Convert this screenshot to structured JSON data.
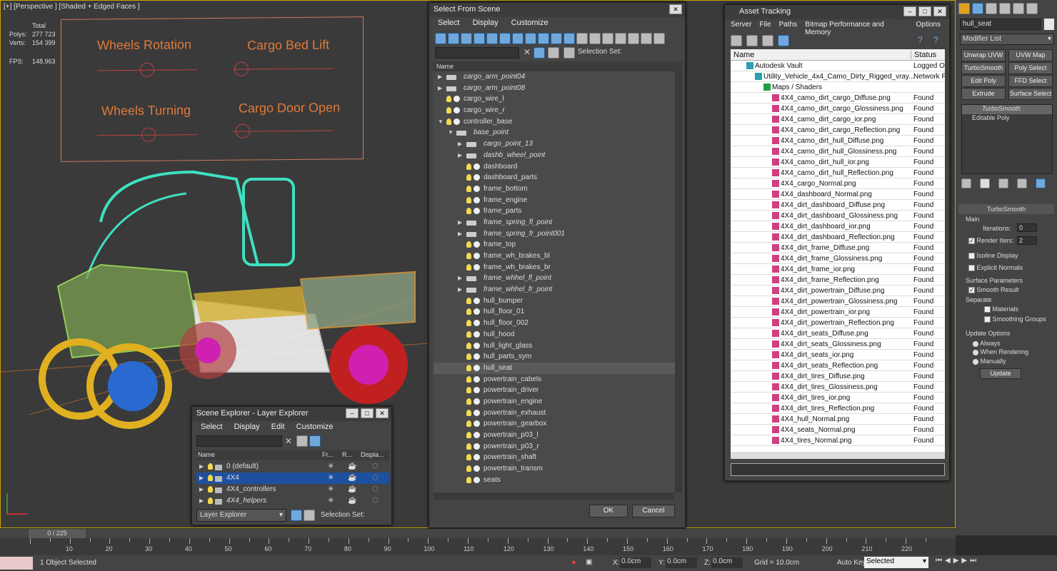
{
  "viewport": {
    "label": "[+] [Perspective ] [Shaded + Edged Faces ]",
    "stats": {
      "total_label": "Total",
      "polys_label": "Polys:",
      "polys": "277 723",
      "verts_label": "Verts:",
      "verts": "154 399",
      "fps_label": "FPS:",
      "fps": "148.963"
    },
    "controls": [
      "Wheels Rotation",
      "Cargo Bed Lift",
      "Wheels Turning",
      "Cargo Door Open"
    ]
  },
  "select_from_scene": {
    "title": "Select From Scene",
    "menu": [
      "Select",
      "Display",
      "Customize"
    ],
    "selection_set_label": "Selection Set:",
    "column_name": "Name",
    "ok": "OK",
    "cancel": "Cancel",
    "rows": [
      {
        "name": "cargo_arm_point04",
        "level": 0,
        "type": "helper",
        "expand": "right",
        "italic": true
      },
      {
        "name": "cargo_arm_point08",
        "level": 0,
        "type": "helper",
        "expand": "right",
        "italic": true
      },
      {
        "name": "cargo_wire_l",
        "level": 0,
        "type": "mesh",
        "expand": "",
        "italic": false
      },
      {
        "name": "cargo_wire_r",
        "level": 0,
        "type": "mesh",
        "expand": "",
        "italic": false
      },
      {
        "name": "controller_base",
        "level": 0,
        "type": "mesh2",
        "expand": "down",
        "italic": false
      },
      {
        "name": "base_point",
        "level": 1,
        "type": "helper",
        "expand": "down",
        "italic": true
      },
      {
        "name": "cargo_point_13",
        "level": 2,
        "type": "helper",
        "expand": "right",
        "italic": true
      },
      {
        "name": "dashb_wheel_point",
        "level": 2,
        "type": "helper",
        "expand": "right",
        "italic": true
      },
      {
        "name": "dashboard",
        "level": 2,
        "type": "mesh",
        "expand": "",
        "italic": false
      },
      {
        "name": "dashboard_parts",
        "level": 2,
        "type": "mesh",
        "expand": "",
        "italic": false
      },
      {
        "name": "frame_bottom",
        "level": 2,
        "type": "mesh",
        "expand": "",
        "italic": false
      },
      {
        "name": "frame_engine",
        "level": 2,
        "type": "mesh",
        "expand": "",
        "italic": false
      },
      {
        "name": "frame_parts",
        "level": 2,
        "type": "mesh",
        "expand": "",
        "italic": false
      },
      {
        "name": "frame_spring_fl_point",
        "level": 2,
        "type": "helper",
        "expand": "right",
        "italic": true
      },
      {
        "name": "frame_spring_fr_point001",
        "level": 2,
        "type": "helper",
        "expand": "right",
        "italic": true
      },
      {
        "name": "frame_top",
        "level": 2,
        "type": "mesh",
        "expand": "",
        "italic": false
      },
      {
        "name": "frame_wh_brakes_bl",
        "level": 2,
        "type": "mesh",
        "expand": "",
        "italic": false
      },
      {
        "name": "frame_wh_brakes_br",
        "level": 2,
        "type": "mesh",
        "expand": "",
        "italic": false
      },
      {
        "name": "frame_whhel_fl_point",
        "level": 2,
        "type": "helper",
        "expand": "right",
        "italic": true
      },
      {
        "name": "frame_whhel_fr_point",
        "level": 2,
        "type": "helper",
        "expand": "right",
        "italic": true
      },
      {
        "name": "hull_bumper",
        "level": 2,
        "type": "mesh",
        "expand": "",
        "italic": false
      },
      {
        "name": "hull_floor_01",
        "level": 2,
        "type": "mesh",
        "expand": "",
        "italic": false
      },
      {
        "name": "hull_floor_002",
        "level": 2,
        "type": "mesh",
        "expand": "",
        "italic": false
      },
      {
        "name": "hull_hood",
        "level": 2,
        "type": "mesh",
        "expand": "",
        "italic": false
      },
      {
        "name": "hull_light_glass",
        "level": 2,
        "type": "mesh",
        "expand": "",
        "italic": false
      },
      {
        "name": "hull_parts_sym",
        "level": 2,
        "type": "mesh",
        "expand": "",
        "italic": false
      },
      {
        "name": "hull_seat",
        "level": 2,
        "type": "mesh",
        "expand": "",
        "italic": false,
        "selected": true
      },
      {
        "name": "powertrain_cabels",
        "level": 2,
        "type": "mesh",
        "expand": "",
        "italic": false
      },
      {
        "name": "powertrain_driver",
        "level": 2,
        "type": "mesh",
        "expand": "",
        "italic": false
      },
      {
        "name": "powertrain_engine",
        "level": 2,
        "type": "mesh",
        "expand": "",
        "italic": false
      },
      {
        "name": "powertrain_exhaust",
        "level": 2,
        "type": "mesh",
        "expand": "",
        "italic": false
      },
      {
        "name": "powertrain_gearbox",
        "level": 2,
        "type": "mesh",
        "expand": "",
        "italic": false
      },
      {
        "name": "powertrain_p03_l",
        "level": 2,
        "type": "mesh",
        "expand": "",
        "italic": false
      },
      {
        "name": "powertrain_p03_r",
        "level": 2,
        "type": "mesh",
        "expand": "",
        "italic": false
      },
      {
        "name": "powertrain_shaft",
        "level": 2,
        "type": "mesh",
        "expand": "",
        "italic": false
      },
      {
        "name": "powertrain_transm",
        "level": 2,
        "type": "mesh",
        "expand": "",
        "italic": false
      },
      {
        "name": "seats",
        "level": 2,
        "type": "mesh",
        "expand": "",
        "italic": false
      }
    ]
  },
  "scene_explorer": {
    "title": "Scene Explorer - Layer Explorer",
    "menu": [
      "Select",
      "Display",
      "Edit",
      "Customize"
    ],
    "columns": [
      "Name",
      "Fr...",
      "R...",
      "Displa..."
    ],
    "layers": [
      "0 (default)",
      "4X4",
      "4X4_controllers",
      "4X4_helpers"
    ],
    "footer_mode": "Layer Explorer",
    "selection_set_label": "Selection Set:"
  },
  "asset_tracking": {
    "title": "Asset Tracking",
    "menu": [
      "Server",
      "File",
      "Paths",
      "Bitmap Performance and Memory",
      "Options"
    ],
    "columns": [
      "Name",
      "Status"
    ],
    "vault": {
      "name": "Autodesk Vault",
      "status": "Logged Ou"
    },
    "file": {
      "name": "Utility_Vehicle_4x4_Camo_Dirty_Rigged_vray...",
      "status": "Network Pa"
    },
    "maps_label": "Maps / Shaders",
    "files": [
      "4X4_camo_dirt_cargo_Diffuse.png",
      "4X4_camo_dirt_cargo_Glossiness.png",
      "4X4_camo_dirt_cargo_ior.png",
      "4X4_camo_dirt_cargo_Reflection.png",
      "4X4_camo_dirt_hull_Diffuse.png",
      "4X4_camo_dirt_hull_Glossiness.png",
      "4X4_camo_dirt_hull_ior.png",
      "4X4_camo_dirt_hull_Reflection.png",
      "4X4_cargo_Normal.png",
      "4X4_dashboard_Normal.png",
      "4X4_dirt_dashboard_Diffuse.png",
      "4X4_dirt_dashboard_Glossiness.png",
      "4X4_dirt_dashboard_ior.png",
      "4X4_dirt_dashboard_Reflection.png",
      "4X4_dirt_frame_Diffuse.png",
      "4X4_dirt_frame_Glossiness.png",
      "4X4_dirt_frame_ior.png",
      "4X4_dirt_frame_Reflection.png",
      "4X4_dirt_powertrain_Diffuse.png",
      "4X4_dirt_powertrain_Glossiness.png",
      "4X4_dirt_powertrain_ior.png",
      "4X4_dirt_powertrain_Reflection.png",
      "4X4_dirt_seats_Diffuse.png",
      "4X4_dirt_seats_Glossiness.png",
      "4X4_dirt_seats_ior.png",
      "4X4_dirt_seats_Reflection.png",
      "4X4_dirt_tires_Diffuse.png",
      "4X4_dirt_tires_Glossiness.png",
      "4X4_dirt_tires_ior.png",
      "4X4_dirt_tires_Reflection.png",
      "4X4_hull_Normal.png",
      "4X4_seats_Normal.png",
      "4X4_tires_Normal.png"
    ],
    "found": "Found"
  },
  "command_panel": {
    "object_name": "hull_seat",
    "modifier_list": "Modifier List",
    "buttons": [
      "Unwrap UVW",
      "UVW Map",
      "TurboSmooth",
      "Poly Select",
      "Edit Poly",
      "FFD Select",
      "Extrude",
      "Surface Select"
    ],
    "stack": [
      "TurboSmooth",
      "Editable Poly"
    ],
    "rollout_title": "TurboSmooth",
    "main_label": "Main",
    "iterations_label": "Iterations:",
    "iterations": "0",
    "render_iters_label": "Render Iters:",
    "render_iters": "2",
    "isoline": "Isoline Display",
    "explicit": "Explicit Normals",
    "surface_params": "Surface Parameters",
    "smooth_result": "Smooth Result",
    "separate": "Separate",
    "materials": "Materials",
    "smoothing_groups": "Smoothing Groups",
    "update_options": "Update Options",
    "always": "Always",
    "when_rendering": "When Rendering",
    "manually": "Manually",
    "update": "Update"
  },
  "timeline": {
    "frame": "0 / 225",
    "ticks": [
      "10",
      "20",
      "30",
      "40",
      "50",
      "60",
      "70",
      "80",
      "90",
      "100",
      "110",
      "120",
      "130",
      "140",
      "150",
      "160",
      "170",
      "180",
      "190",
      "200",
      "210",
      "220"
    ]
  },
  "status": {
    "selected": "1 Object Selected",
    "x_label": "X:",
    "x": "0.0cm",
    "y_label": "Y:",
    "y": "0.0cm",
    "z_label": "Z:",
    "z": "0.0cm",
    "grid": "Grid = 10.0cm",
    "autokey": "Auto Key",
    "selected_mode": "Selected"
  },
  "colors": {
    "viewport_border": "#c8a200",
    "selection": "#1e50a0",
    "found_text": "#111"
  }
}
